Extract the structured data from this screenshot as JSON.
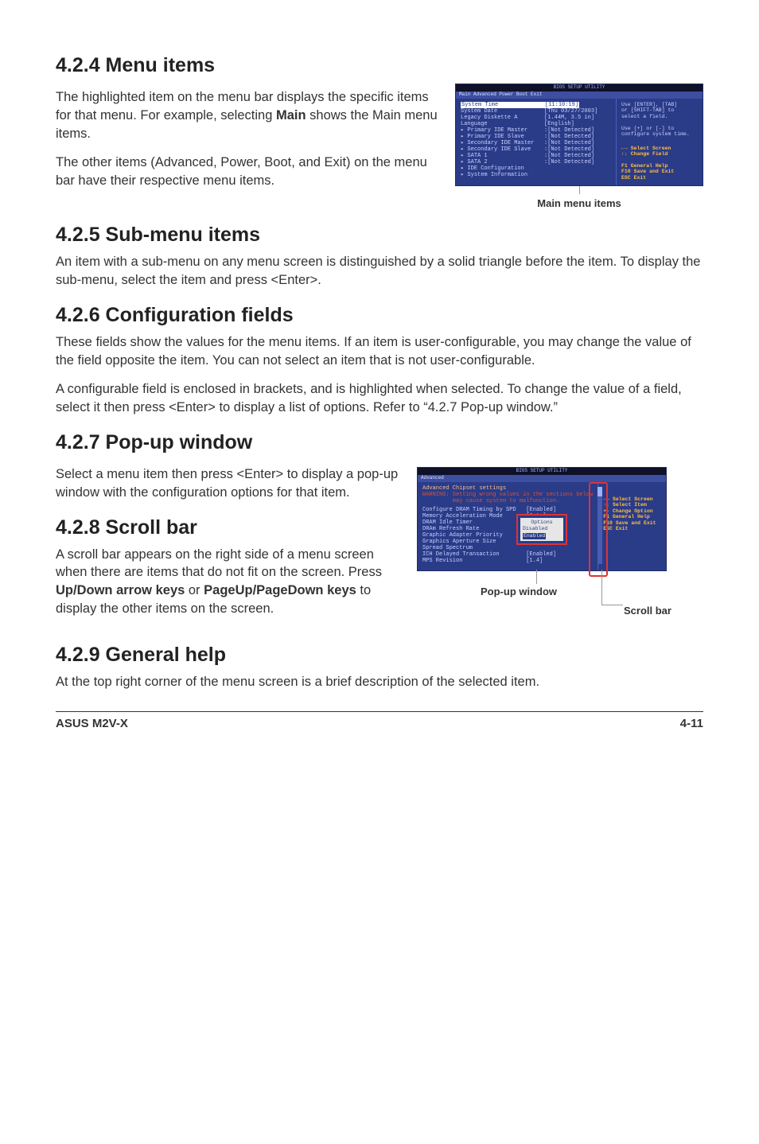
{
  "s424": {
    "heading": "4.2.4  Menu items",
    "p1": "The highlighted item on the menu bar displays the specific items for that menu. For example, selecting ",
    "p1b": "Main",
    "p1c": " shows the Main menu items.",
    "p2": "The other items (Advanced, Power, Boot, and Exit) on the menu bar have their respective menu items."
  },
  "s425": {
    "heading": "4.2.5  Sub-menu items",
    "p1": "An item with a sub-menu on any menu screen is distinguished by a solid triangle before the item. To display the sub-menu, select the item and press <Enter>."
  },
  "s426": {
    "heading": "4.2.6  Configuration fields",
    "p1": "These fields show the values for the menu items. If an item is user-configurable, you may change the value of the field opposite the item. You can not select an item that is not user-configurable.",
    "p2": "A configurable field is enclosed in brackets, and is highlighted when selected. To change the value of a field, select it then press <Enter> to display a list of options. Refer to “4.2.7 Pop-up window.”"
  },
  "s427": {
    "heading": "4.2.7  Pop-up window",
    "p1": "Select a menu item then press <Enter> to display a pop-up window with the configuration options for that item."
  },
  "s428": {
    "heading": "4.2.8  Scroll bar",
    "p1a": "A scroll bar appears on the right side of a menu screen when there are items that do not fit on the screen. Press ",
    "p1b": "Up/Down arrow keys",
    "p1c": " or ",
    "p1d": "PageUp/PageDown keys",
    "p1e": " to display the other items on the screen."
  },
  "s429": {
    "heading": "4.2.9  General help",
    "p1": "At the top right corner of the menu screen is a brief description of the selected item."
  },
  "bios1": {
    "top": "BIOS SETUP UTILITY",
    "menubar": " Main   Advanced   Power   Boot   Exit",
    "left": [
      "System Time              [11:10:19]",
      "System Date              [Thu 03/27/2003]",
      "Legacy Diskette A        [1.44M, 3.5 in]",
      "Language                 [English]",
      "",
      "▸ Primary IDE Master     :[Not Detected]",
      "▸ Primary IDE Slave      :[Not Detected]",
      "▸ Secondary IDE Master   :[Not Detected]",
      "▸ Secondary IDE Slave    :[Not Detected]",
      "▸ SATA 1                 :[Not Detected]",
      "▸ SATA 2                 :[Not Detected]",
      "▸ IDE Configuration",
      "",
      "▸ System Information"
    ],
    "right_top": "Use [ENTER], [TAB]\nor [SHIFT-TAB] to\nselect a field.\n\nUse [+] or [-] to\nconfigure system time.",
    "right_nav": "←→   Select Screen\n↑↓   Change Field\n\nF1   General Help\nF10  Save and Exit\nESC  Exit",
    "caption": "Main menu items"
  },
  "bios2": {
    "top": "BIOS SETUP UTILITY",
    "menubar": " Advanced",
    "title": "Advanced Chipset settings",
    "warn": "WARNING: Setting wrong values in the sections below\n         may cause system to malfunction.",
    "lines": [
      "Configure DRAM Timing by SPD   [Enabled]",
      "Memory Acceleration Mode       [Auto]",
      "DRAM Idle Timer",
      "DRAm Refresh Rate",
      "",
      "Graphic Adapter Priority",
      "Graphics Aperture Size         [Enabled]",
      "Spread Spectrum",
      "",
      "ICH Delayed Transaction        [Enabled]",
      "",
      "MPS Revision                   [1.4]"
    ],
    "popup": {
      "title": "Options",
      "opt1": "Disabled",
      "opt2": "Enabled"
    },
    "right_nav": "←→   Select Screen\n↑↓   Select Item\n+-   Change Option\nF1   General Help\nF10  Save and Exit\nESC  Exit",
    "caption_popup": "Pop-up window",
    "caption_scroll": "Scroll bar"
  },
  "footer": {
    "left": "ASUS M2V-X",
    "right": "4-11"
  },
  "chart_data": null
}
